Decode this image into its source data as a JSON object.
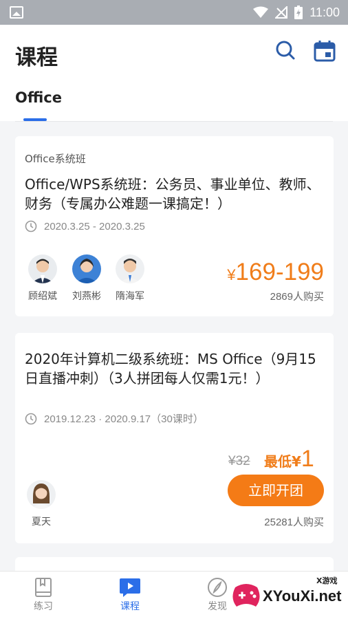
{
  "status_bar": {
    "time": "11:00"
  },
  "header": {
    "title": "课程",
    "tabs": [
      {
        "label": "Office"
      }
    ]
  },
  "courses": [
    {
      "series": "Office系统班",
      "title": "Office/WPS系统班：公务员、事业单位、教师、财务（专属办公难题一课搞定！）",
      "date": "2020.3.25 - 2020.3.25",
      "teachers": [
        {
          "name": "顾绍斌"
        },
        {
          "name": "刘燕彬"
        },
        {
          "name": "隋海军"
        }
      ],
      "price_yen": "¥",
      "price": "169-199",
      "buyers": "2869人购买"
    },
    {
      "title": "2020年计算机二级系统班：MS Office（9月15日直播冲刺）（3人拼团每人仅需1元！）",
      "date": "2019.12.23 · 2020.9.17（30课时）",
      "teachers": [
        {
          "name": "夏天"
        }
      ],
      "original_price": "¥32",
      "min_price_label": "最低",
      "min_price_yen": "¥",
      "min_price": "1",
      "button": "立即开团",
      "buyers": "25281人购买"
    }
  ],
  "tabbar": {
    "items": [
      {
        "label": "练习"
      },
      {
        "label": "课程"
      },
      {
        "label": "发现"
      }
    ]
  },
  "watermark": {
    "brand": "XYouXi.net",
    "small": "X游戏"
  },
  "colors": {
    "accent": "#2b6ee8",
    "price": "#f07d1a",
    "button": "#f47b16"
  }
}
